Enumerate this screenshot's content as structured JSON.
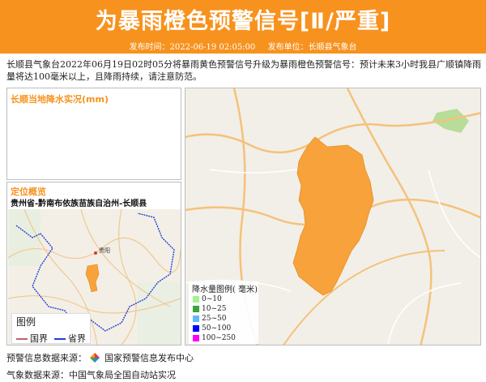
{
  "banner": {
    "title": "为暴雨橙色预警信号[Ⅱ/严重]",
    "publish_time_label": "发布时间：2022-06-19 02:05:00",
    "publish_unit_label": "发布单位：长顺县气象台",
    "color": "#f7921e"
  },
  "description": "长顺县气象台2022年06月19日02时05分将暴雨黄色预警信号升级为暴雨橙色预警信号：预计未来3小时我县广顺镇降雨量将达100毫米以上，且降雨持续，请注意防范。",
  "rain_panel": {
    "title": "长顺当地降水实况(mm)"
  },
  "location_panel": {
    "title": "定位概览",
    "region": "贵州省-黔南布依族苗族自治州-长顺县",
    "map_city_label": "贵阳",
    "legend": {
      "title": "图例",
      "items": [
        {
          "label": "国界",
          "color": "#c06070"
        },
        {
          "label": "省界",
          "color": "#1d3fd6"
        }
      ]
    }
  },
  "main_map": {
    "warning_area_color": "#f7a23b",
    "legend": {
      "title": "降水量图例( 毫米)",
      "items": [
        {
          "label": "0~10",
          "color": "#a6f28f"
        },
        {
          "label": "10~25",
          "color": "#3aa53b"
        },
        {
          "label": "25~50",
          "color": "#61b8ff"
        },
        {
          "label": "50~100",
          "color": "#0000fe"
        },
        {
          "label": "100~250",
          "color": "#fa00fa"
        }
      ]
    }
  },
  "footer": {
    "warning_source": "预警信息数据来源：",
    "warning_source_name": "国家预警信息发布中心",
    "weather_source": "气象数据来源：中国气象局全国自动站实况"
  }
}
